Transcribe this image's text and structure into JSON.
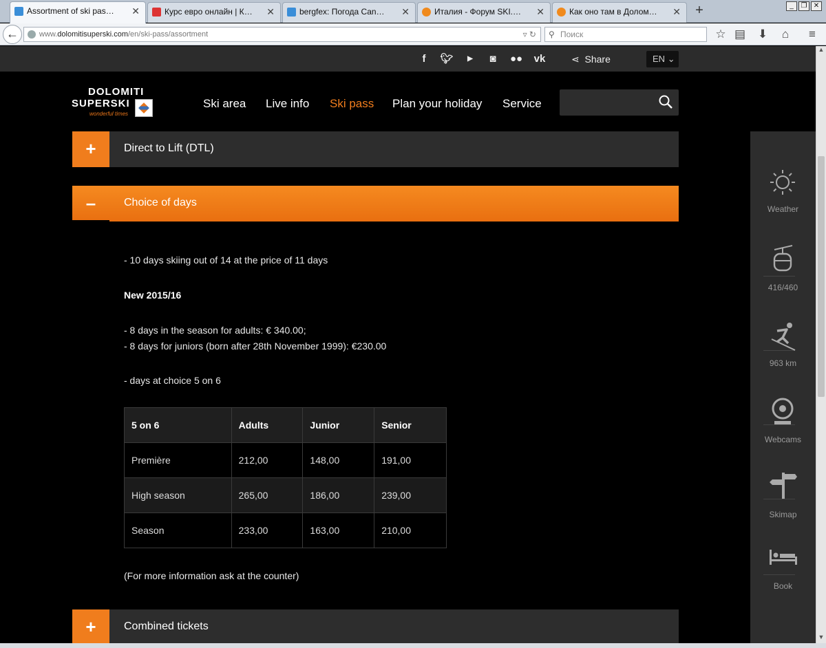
{
  "browser": {
    "tabs": [
      {
        "label": "Assortment of ski passes D...",
        "favicon_color": "#3a8ed8"
      },
      {
        "label": "Курс евро онлайн | Курс е...",
        "favicon_color": "#d33"
      },
      {
        "label": "bergfex: Погода Canazei - ...",
        "favicon_color": "#3a8ed8"
      },
      {
        "label": "Италия - Форум SKI.RU",
        "favicon_color": "#f08a1d"
      },
      {
        "label": "Как оно там в Доломитах ...",
        "favicon_color": "#f08a1d"
      }
    ],
    "url_prefix": "www.",
    "url_host": "dolomitisuperski.com",
    "url_path": "/en/ski-pass/assortment",
    "search_placeholder": "Поиск"
  },
  "site": {
    "social": [
      "f",
      "t",
      "yt",
      "ig",
      "flickr",
      "vk"
    ],
    "share_label": "Share",
    "lang": "EN",
    "logo": {
      "line1": "DOLOMITI",
      "line2": "SUPERSKI",
      "tagline": "wonderful times"
    },
    "nav": [
      {
        "label": "Ski area",
        "active": false
      },
      {
        "label": "Live info",
        "active": false
      },
      {
        "label": "Ski pass",
        "active": true
      },
      {
        "label": "Plan your holiday",
        "active": false
      },
      {
        "label": "Service",
        "active": false
      }
    ],
    "accordions": {
      "dtl": {
        "sign": "+",
        "title": "Direct to Lift (DTL)"
      },
      "choice": {
        "sign": "–",
        "title": "Choice of days"
      },
      "combined": {
        "sign": "+",
        "title": "Combined tickets"
      }
    },
    "content": {
      "line1": "- 10 days skiing out of 14 at the price of 11 days",
      "new_heading": "New 2015/16",
      "line2": "- 8 days in the season for adults: € 340.00;",
      "line3": "- 8 days for juniors (born after 28th November 1999): €230.00",
      "line4": "- days at choice 5 on 6",
      "footnote": "(For more information ask at the counter)"
    },
    "table": {
      "headers": [
        "5 on 6",
        "Adults",
        "Junior",
        "Senior"
      ],
      "rows": [
        [
          "Première",
          "212,00",
          "148,00",
          "191,00"
        ],
        [
          "High season",
          "265,00",
          "186,00",
          "239,00"
        ],
        [
          "Season",
          "233,00",
          "163,00",
          "210,00"
        ]
      ]
    },
    "sidebar": [
      {
        "label": "Weather",
        "icon": "sun-icon"
      },
      {
        "label": "416/460",
        "icon": "cable-car-icon"
      },
      {
        "label": "963 km",
        "icon": "skier-icon"
      },
      {
        "label": "Webcams",
        "icon": "webcam-icon"
      },
      {
        "label": "Skimap",
        "icon": "signpost-icon"
      },
      {
        "label": "Book",
        "icon": "bed-icon"
      }
    ],
    "accent": "#f07d1d"
  }
}
